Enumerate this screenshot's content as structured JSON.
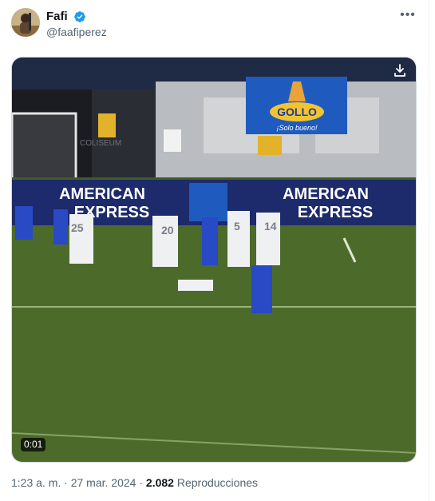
{
  "author": {
    "display_name": "Fafi",
    "handle": "@faafiperez",
    "verified": true
  },
  "media": {
    "type": "video",
    "duration": "0:01",
    "ads": {
      "sponsor_brand": "GOLLO",
      "sponsor_tagline": "¡Solo bueno!",
      "board_text_line1": "AMERICAN",
      "board_text_line2": "EXPRESS",
      "stand_text": "COLISEUM"
    },
    "players_visible": [
      "25",
      "20",
      "5",
      "14"
    ]
  },
  "meta": {
    "time": "1:23 a. m.",
    "separator": "·",
    "date": "27 mar. 2024",
    "separator2": "·",
    "views_count": "2.082",
    "views_label": "Reproducciones"
  },
  "colors": {
    "verified_blue": "#1d9bf0",
    "text_secondary": "#536471",
    "pitch_green": "#4b6b2a",
    "board_navy": "#1d2a6b",
    "team_blue": "#2a49c5"
  },
  "icons": {
    "more": "more-icon",
    "verified": "verified-badge-icon",
    "download": "download-icon"
  }
}
